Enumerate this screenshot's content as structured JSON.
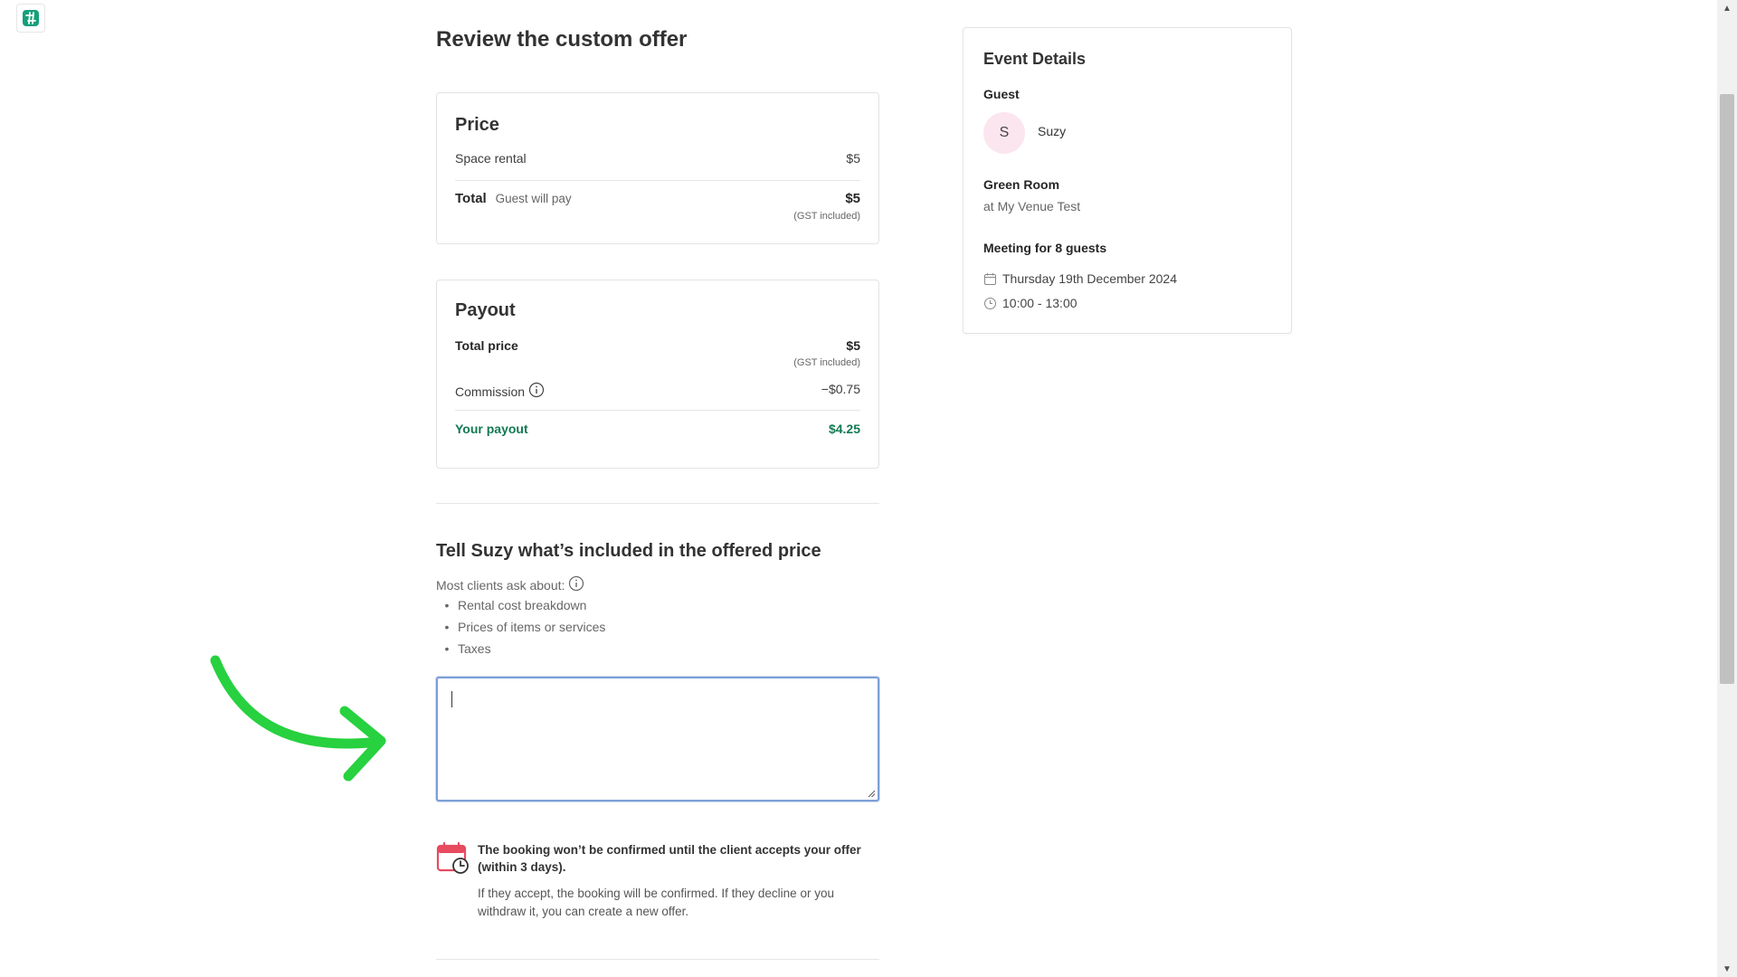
{
  "page": {
    "title": "Review the custom offer"
  },
  "price": {
    "title": "Price",
    "space_rental_label": "Space rental",
    "space_rental_value": "$5",
    "total_label": "Total",
    "total_note": "Guest will pay",
    "total_value": "$5",
    "total_tax_note": "(GST included)"
  },
  "payout": {
    "title": "Payout",
    "total_price_label": "Total price",
    "total_price_value": "$5",
    "total_price_tax_note": "(GST included)",
    "commission_label": "Commission",
    "commission_value": "−$0.75",
    "your_payout_label": "Your payout",
    "your_payout_value": "$4.25"
  },
  "included": {
    "title": "Tell Suzy what’s included in the offered price",
    "ask_label": "Most clients ask about:",
    "bullets": [
      "Rental cost breakdown",
      "Prices of items or services",
      "Taxes"
    ],
    "textarea_value": ""
  },
  "notice": {
    "bold_text": "The booking won’t be confirmed until the client accepts your offer (within 3 days).",
    "body_text": "If they accept, the booking will be confirmed. If they decline or you withdraw it, you can create a new offer."
  },
  "event": {
    "title": "Event Details",
    "guest_label": "Guest",
    "guest_initial": "S",
    "guest_name": "Suzy",
    "room_name": "Green Room",
    "venue_text": "at My Venue Test",
    "meeting_text": "Meeting for 8 guests",
    "date_text": "Thursday 19th December 2024",
    "time_text": "10:00 - 13:00"
  },
  "colors": {
    "accent_green": "#127a52",
    "arrow_green": "#27d13f",
    "focus_blue": "#7c9fd8",
    "calendar_red": "#e84a5f"
  },
  "icons": {
    "logo": "venue-logo-icon",
    "info": "info-icon",
    "calendar": "calendar-icon",
    "clock": "clock-icon",
    "calendar_clock": "calendar-clock-icon",
    "arrow": "curved-arrow-icon"
  }
}
